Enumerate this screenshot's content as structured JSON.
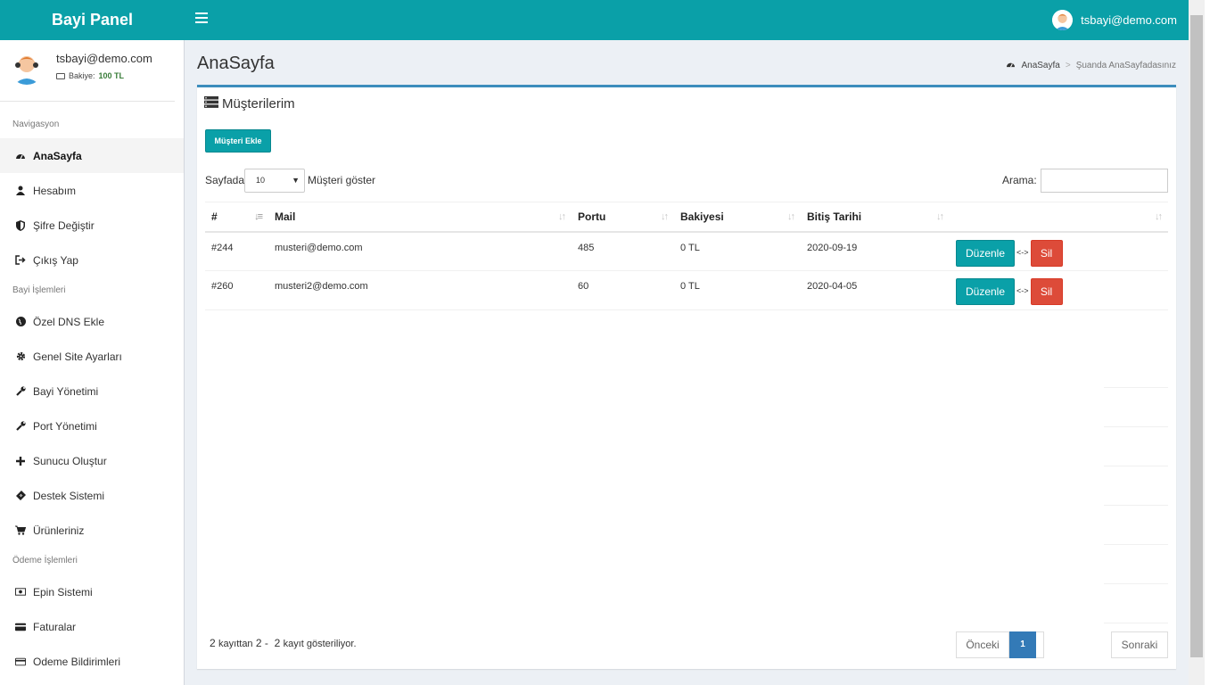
{
  "app": {
    "title": "Bayi Panel",
    "user_email": "tsbayi@demo.com"
  },
  "sidebar": {
    "user_name": "tsbayi@demo.com",
    "balance_label": "Bakiye:",
    "balance_value": "100 TL",
    "sections": [
      {
        "header": "Navigasyon",
        "items": [
          "AnaSayfa",
          "Hesabım",
          "Şifre Değiştir",
          "Çıkış Yap"
        ]
      },
      {
        "header": "Bayi İşlemleri",
        "items": [
          "Özel DNS Ekle",
          "Genel Site Ayarları",
          "Bayi Yönetimi",
          "Port Yönetimi",
          "Sunucu Oluştur",
          "Destek Sistemi",
          "Ürünleriniz"
        ]
      },
      {
        "header": "Ödeme İşlemleri",
        "items": [
          "Epin Sistemi",
          "Faturalar",
          "Odeme Bildirimleri"
        ]
      }
    ]
  },
  "page": {
    "title": "AnaSayfa",
    "breadcrumb_home": "AnaSayfa",
    "breadcrumb_current": "Şuanda AnaSayfadasınız"
  },
  "box": {
    "title": "Müşterilerim",
    "add_button": "Müşteri Ekle",
    "length_prefix": "Sayfada",
    "length_value": "10",
    "length_suffix": "Müşteri göster",
    "search_label": "Arama:"
  },
  "table": {
    "headers": [
      "#",
      "Mail",
      "Portu",
      "Bakiyesi",
      "Bitiş Tarihi",
      ""
    ],
    "rows": [
      {
        "id": "#244",
        "mail": "musteri@demo.com",
        "port": "485",
        "balance": "0 TL",
        "end_date": "2020-09-19"
      },
      {
        "id": "#260",
        "mail": "musteri2@demo.com",
        "port": "60",
        "balance": "0 TL",
        "end_date": "2020-04-05"
      }
    ],
    "edit_label": "Düzenle",
    "sep_label": "<->",
    "delete_label": "Sil"
  },
  "footer": {
    "info_total": "2",
    "info_text_1": "kayıttan",
    "info_range": "2 -  2",
    "info_text_2": "kayıt gösteriliyor.",
    "prev": "Önceki",
    "page": "1",
    "next": "Sonraki"
  },
  "colors": {
    "header": "#0aa0a8",
    "primary_top": "#3c8dbc",
    "delete": "#dd4b39",
    "pager_active": "#337ab7"
  }
}
